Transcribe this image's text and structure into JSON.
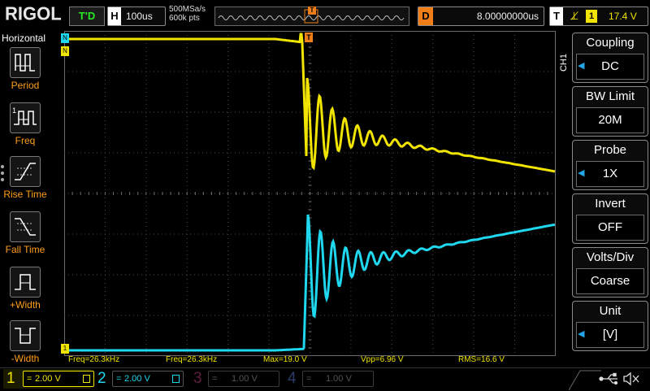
{
  "top": {
    "logo": "RIGOL",
    "run_state": "T'D",
    "timebase_key": "H",
    "timebase": "100us",
    "sample_rate": "500MSa/s",
    "memory_depth": "600k pts",
    "trigger_marker": "T",
    "delay_key": "D",
    "delay": "8.00000000us",
    "trigger_key": "T",
    "trigger_source": "1",
    "trigger_level": "17.4 V",
    "trigger_edge_icon": "rising-edge-icon"
  },
  "left_menu": {
    "title": "Horizontal",
    "items": [
      {
        "label": "Period",
        "icon": "period-measure-icon"
      },
      {
        "label": "Freq",
        "icon": "frequency-measure-icon"
      },
      {
        "label": "Rise Time",
        "icon": "rise-time-icon"
      },
      {
        "label": "Fall Time",
        "icon": "fall-time-icon"
      },
      {
        "label": "+Width",
        "icon": "positive-width-icon"
      },
      {
        "label": "-Width",
        "icon": "negative-width-icon"
      }
    ]
  },
  "measurements": {
    "freq1": "Freq=26.3kHz",
    "freq2": "Freq=26.3kHz",
    "max": "Max=19.0 V",
    "vpp": "Vpp=6.96 V",
    "rms": "RMS=16.6 V"
  },
  "right_menu": {
    "channel_tag": "CH1",
    "items": [
      {
        "title": "Coupling",
        "value": "DC",
        "has_arrow": true
      },
      {
        "title": "BW Limit",
        "value": "20M",
        "has_arrow": false
      },
      {
        "title": "Probe",
        "value": "1X",
        "has_arrow": true
      },
      {
        "title": "Invert",
        "value": "OFF",
        "has_arrow": false
      },
      {
        "title": "Volts/Div",
        "value": "Coarse",
        "has_arrow": false
      },
      {
        "title": "Unit",
        "value": "[V]",
        "has_arrow": true
      }
    ]
  },
  "channels": [
    {
      "num": "1",
      "scale": "2.00 V",
      "coupling": "=",
      "color": "#f0e400",
      "active": true
    },
    {
      "num": "2",
      "scale": "2.00 V",
      "coupling": "=",
      "color": "#1fd7ee",
      "active": true
    },
    {
      "num": "3",
      "scale": "1.00 V",
      "coupling": "=",
      "color": "#c4307e",
      "active": false
    },
    {
      "num": "4",
      "scale": "1.00 V",
      "coupling": "=",
      "color": "#3d67d8",
      "active": false
    }
  ],
  "colors": {
    "ch1": "#f0e400",
    "ch2": "#1fd7ee",
    "accent_orange": "#f07f1a",
    "menu_label": "#ff9f1a",
    "grid": "#4a4a4a"
  },
  "status_icons": [
    "usb-icon",
    "sound-muted-icon"
  ]
}
